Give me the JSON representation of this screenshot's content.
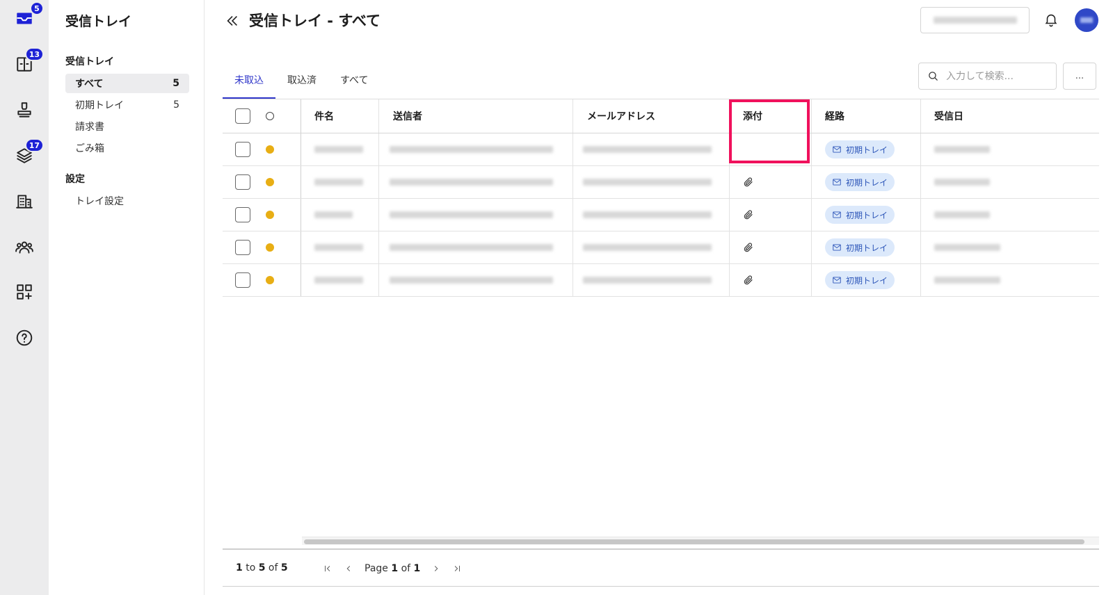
{
  "rail": {
    "items": [
      {
        "name": "inbox",
        "icon": "inbox-icon",
        "badge": "5"
      },
      {
        "name": "documents",
        "icon": "document-panel-icon",
        "badge": "13"
      },
      {
        "name": "stamp",
        "icon": "stamp-icon",
        "badge": ""
      },
      {
        "name": "layers",
        "icon": "layers-icon",
        "badge": "17"
      },
      {
        "name": "buildings",
        "icon": "building-icon",
        "badge": ""
      },
      {
        "name": "members",
        "icon": "people-icon",
        "badge": ""
      },
      {
        "name": "apps",
        "icon": "apps-add-icon",
        "badge": ""
      },
      {
        "name": "help",
        "icon": "help-icon",
        "badge": ""
      }
    ]
  },
  "sidebar": {
    "title": "受信トレイ",
    "section_inbox": "受信トレイ",
    "items": [
      {
        "label": "すべて",
        "count": "5"
      },
      {
        "label": "初期トレイ",
        "count": "5"
      },
      {
        "label": "請求書",
        "count": ""
      },
      {
        "label": "ごみ箱",
        "count": ""
      }
    ],
    "section_settings": "設定",
    "settings_items": [
      {
        "label": "トレイ設定"
      }
    ]
  },
  "header": {
    "title": "受信トレイ - すべて"
  },
  "tabs": [
    {
      "label": "未取込"
    },
    {
      "label": "取込済"
    },
    {
      "label": "すべて"
    }
  ],
  "search": {
    "placeholder": "入力して検索..."
  },
  "more_label": "...",
  "table": {
    "columns": [
      "件名",
      "送信者",
      "メールアドレス",
      "添付",
      "経路",
      "受信日"
    ],
    "rows": [
      {
        "attachment": false,
        "route": "初期トレイ"
      },
      {
        "attachment": true,
        "route": "初期トレイ"
      },
      {
        "attachment": true,
        "route": "初期トレイ"
      },
      {
        "attachment": true,
        "route": "初期トレイ"
      },
      {
        "attachment": true,
        "route": "初期トレイ"
      }
    ]
  },
  "pagination": {
    "from": "1",
    "to_word": "to",
    "to": "5",
    "of_word": "of",
    "total": "5",
    "page_word": "Page",
    "page": "1",
    "page_of_word": "of",
    "page_total": "1"
  },
  "colors": {
    "accent": "#2e35c9",
    "badge": "#1e22d6",
    "unread_dot": "#e8ae14",
    "highlight": "#f0115c",
    "route_badge_bg": "#dce9fb"
  }
}
